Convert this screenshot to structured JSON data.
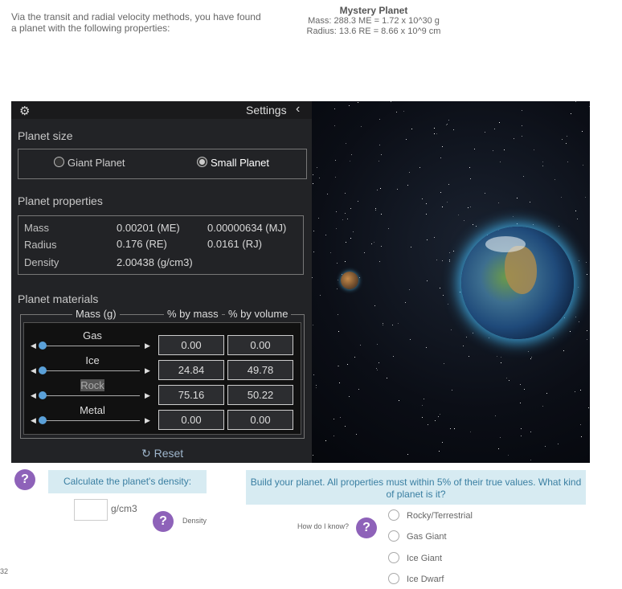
{
  "intro_text": "Via the transit and radial velocity methods, you have found a planet with the following properties:",
  "mystery": {
    "title": "Mystery Planet",
    "mass_line": "Mass: 288.3 ME = 1.72 x 10^30 g",
    "radius_line": "Radius: 13.6 RE = 8.66 x 10^9 cm"
  },
  "panel": {
    "settings_label": "Settings",
    "collapse_glyph": "‹",
    "planet_size_title": "Planet size",
    "size_options": [
      {
        "label": "Giant Planet",
        "selected": false
      },
      {
        "label": "Small Planet",
        "selected": true
      }
    ],
    "properties_title": "Planet properties",
    "properties": [
      {
        "label": "Mass",
        "value1": "0.00201 (ME)",
        "value2": "0.00000634 (MJ)"
      },
      {
        "label": "Radius",
        "value1": "0.176 (RE)",
        "value2": "0.0161 (RJ)"
      },
      {
        "label": "Density",
        "value1": "2.00438 (g/cm3)",
        "value2": ""
      }
    ],
    "materials_title": "Planet materials",
    "col_mass": "Mass (g)",
    "col_pct_mass": "% by mass",
    "col_pct_volume": "% by volume",
    "materials": [
      {
        "name": "Gas",
        "pct_mass": "0.00",
        "pct_volume": "0.00"
      },
      {
        "name": "Ice",
        "pct_mass": "24.84",
        "pct_volume": "49.78"
      },
      {
        "name": "Rock",
        "pct_mass": "75.16",
        "pct_volume": "50.22"
      },
      {
        "name": "Metal",
        "pct_mass": "0.00",
        "pct_volume": "0.00"
      }
    ],
    "reset_label": "Reset"
  },
  "calc": {
    "prompt": "Calculate the planet's density:",
    "unit": "g/cm3",
    "density_label": "Density",
    "input_value": ""
  },
  "build": {
    "prompt": "Build your planet. All properties must within 5% of their true values. What kind of planet is it?",
    "how_label": "How do I know?",
    "options": [
      "Rocky/Terrestrial",
      "Gas Giant",
      "Ice Giant",
      "Ice Dwarf"
    ]
  },
  "page_number": "32",
  "colors": {
    "accent_purple": "#8e62b9",
    "panel_bg": "#222326",
    "info_box": "#d7ebf2"
  }
}
